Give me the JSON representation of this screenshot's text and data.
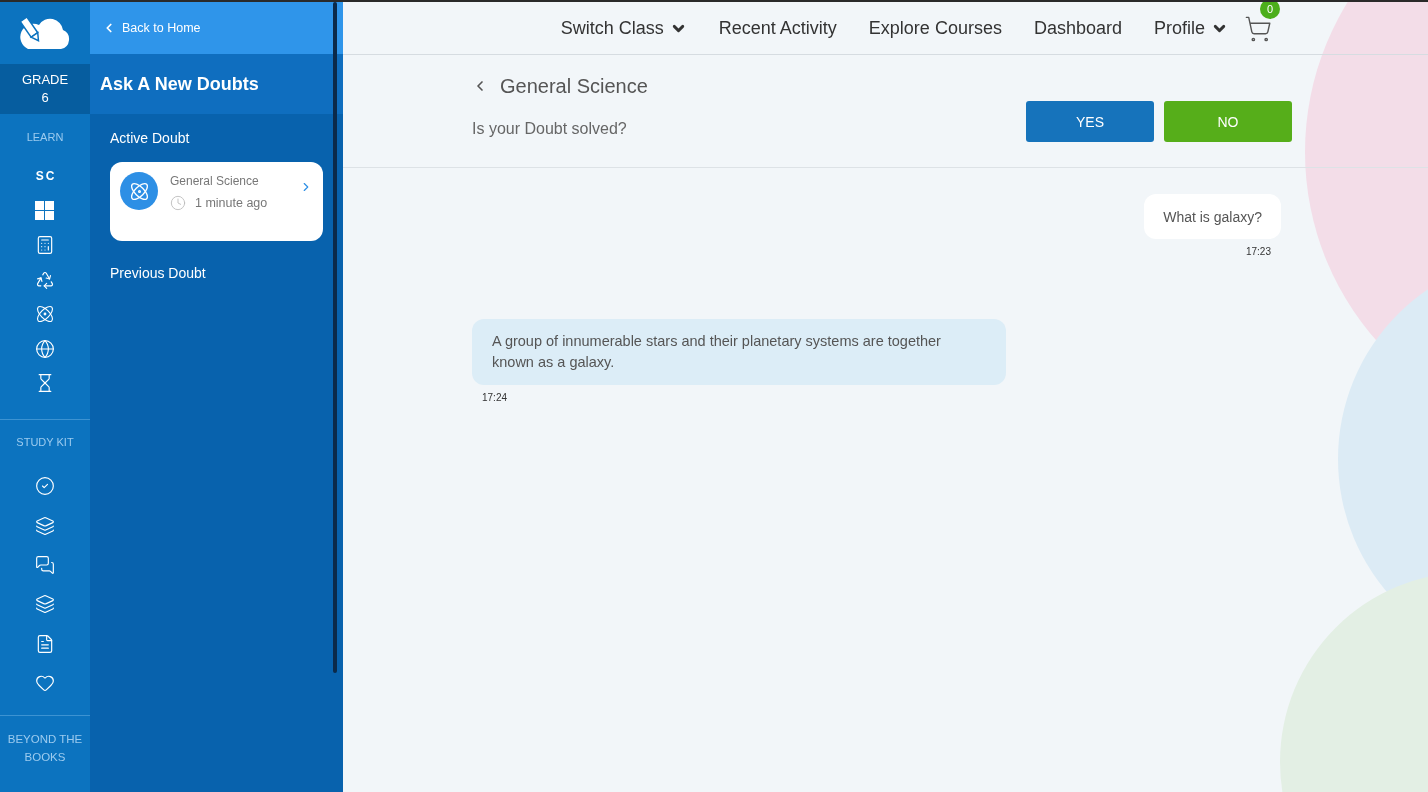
{
  "rail": {
    "grade_label": "GRADE",
    "grade_value": "6",
    "learn_title": "LEARN",
    "subject_code": "SC",
    "study_kit_title": "STUDY KIT",
    "beyond_title": "BEYOND THE BOOKS"
  },
  "doubts_panel": {
    "back_link": "Back to Home",
    "title": "Ask A New Doubts",
    "active_heading": "Active Doubt",
    "active": [
      {
        "subject": "General Science",
        "time": "1 minute ago"
      }
    ],
    "previous_heading": "Previous Doubt"
  },
  "nav": {
    "items": [
      {
        "label": "Switch Class",
        "dropdown": true
      },
      {
        "label": "Recent Activity",
        "dropdown": false
      },
      {
        "label": "Explore Courses",
        "dropdown": false
      },
      {
        "label": "Dashboard",
        "dropdown": false
      },
      {
        "label": "Profile",
        "dropdown": true
      }
    ],
    "cart_count": "0"
  },
  "doubt": {
    "subject": "General Science",
    "question": "Is your Doubt solved?",
    "buttons": [
      {
        "kind": "yes",
        "label": "YES"
      },
      {
        "kind": "no",
        "label": "NO"
      }
    ]
  },
  "messages": [
    {
      "kind": "sent",
      "text": "What is galaxy?",
      "time": "17:23"
    },
    {
      "kind": "received",
      "text": "A group of innumerable stars and their planetary systems are together known as a galaxy.",
      "time": "17:24"
    }
  ]
}
